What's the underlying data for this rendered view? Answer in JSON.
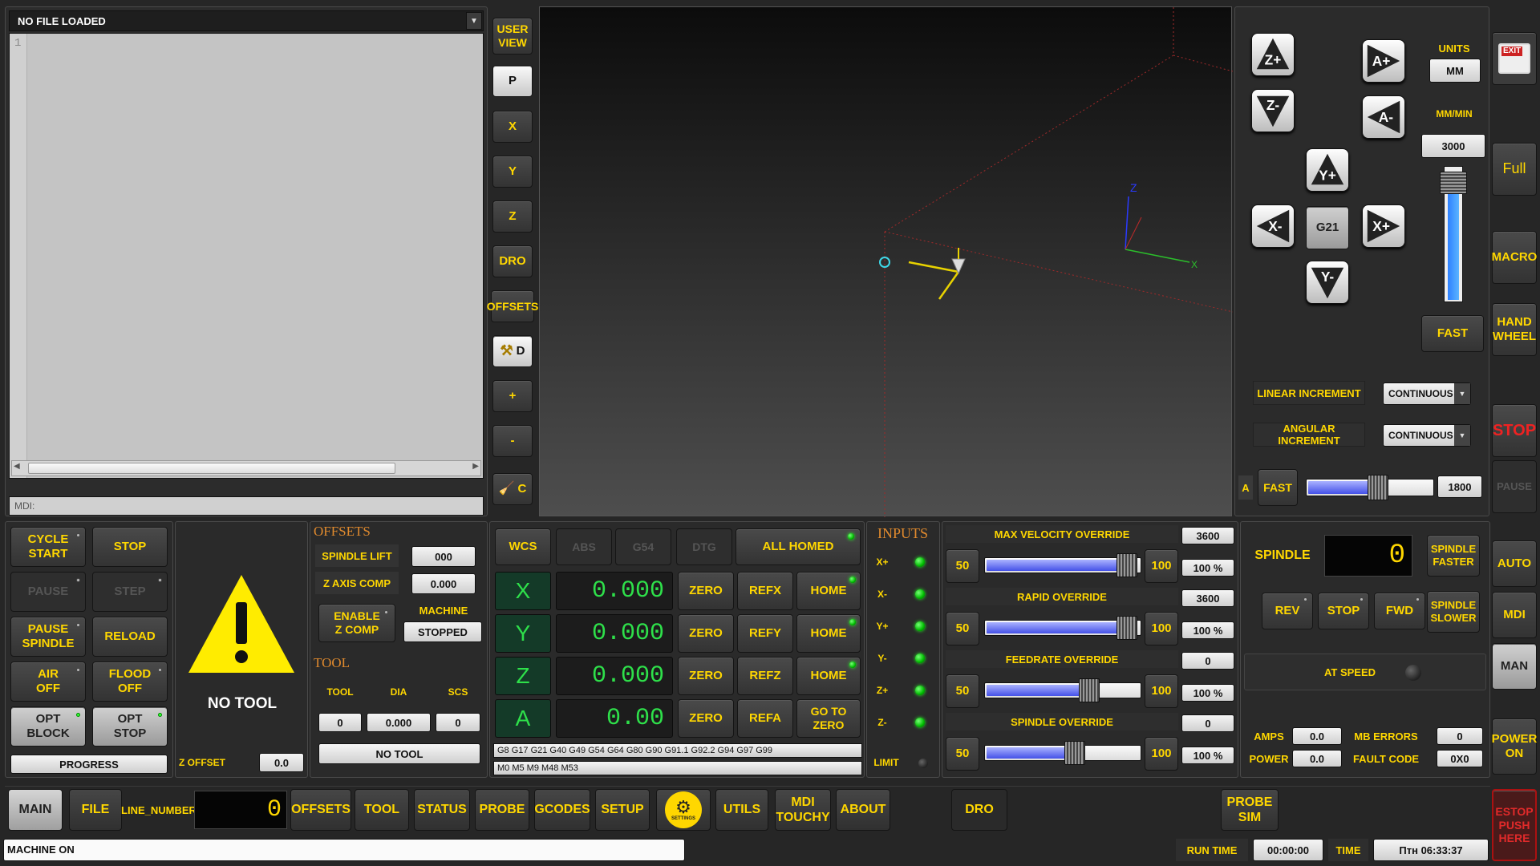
{
  "editor": {
    "title": "NO FILE LOADED",
    "line_number": "1",
    "mdi_label": "MDI:"
  },
  "view_toolbar": {
    "user_view": "USER\nVIEW",
    "p": "P",
    "x": "X",
    "y": "Y",
    "z": "Z",
    "dro": "DRO",
    "offsets": "OFFSETS",
    "d": "D",
    "plus": "+",
    "minus": "-",
    "c": "C"
  },
  "preview": {
    "axis_x": "X",
    "axis_z": "Z"
  },
  "jog": {
    "z_plus": "Z+",
    "z_minus": "Z-",
    "a_plus": "A+",
    "a_minus": "A-",
    "y_plus": "Y+",
    "y_minus": "Y-",
    "x_plus": "X+",
    "x_minus": "X-",
    "g21": "G21",
    "units_label": "UNITS",
    "units_value": "MM",
    "rate_unit": "MM/MIN",
    "rate_value": "3000",
    "jog_speed_pct": 0.88,
    "fast": "FAST",
    "linear_increment": "LINEAR INCREMENT",
    "linear_value": "CONTINUOUS",
    "angular_increment": "ANGULAR INCREMENT",
    "angular_value": "CONTINUOUS",
    "a_label": "A",
    "a_fast": "FAST",
    "a_value": "1800",
    "a_slider_pct": 0.58
  },
  "right_bar": {
    "exit": "EXIT",
    "full": "Full",
    "macro": "MACRO",
    "hand_wheel": "HAND\nWHEEL",
    "stop": "STOP",
    "pause": "PAUSE",
    "auto": "AUTO",
    "mdi": "MDI",
    "man": "MAN",
    "power_on": "POWER\nON",
    "estop": "ESTOP\nPUSH\nHERE"
  },
  "program": {
    "cycle_start": "CYCLE\nSTART",
    "stop": "STOP",
    "pause": "PAUSE",
    "step": "STEP",
    "pause_spindle": "PAUSE\nSPINDLE",
    "reload": "RELOAD",
    "air_off": "AIR\nOFF",
    "flood_off": "FLOOD\nOFF",
    "opt_block": "OPT\nBLOCK",
    "opt_stop": "OPT\nSTOP",
    "progress": "PROGRESS"
  },
  "tool_display": {
    "no_tool": "NO TOOL",
    "z_offset_label": "Z OFFSET",
    "z_offset_value": "0.0"
  },
  "offsets_panel": {
    "title": "OFFSETS",
    "spindle_lift_label": "SPINDLE LIFT",
    "spindle_lift_value": "000",
    "z_axis_comp_label": "Z AXIS COMP",
    "z_axis_comp_value": "0.000",
    "enable_z_comp": "ENABLE\nZ COMP",
    "machine_label": "MACHINE",
    "machine_state": "STOPPED",
    "tool_title": "TOOL",
    "col_tool": "TOOL",
    "col_dia": "DIA",
    "col_scs": "SCS",
    "tool_value": "0",
    "dia_value": "0.000",
    "scs_value": "0",
    "no_tool": "NO TOOL"
  },
  "dro": {
    "wcs": "WCS",
    "abs": "ABS",
    "g54": "G54",
    "dtg": "DTG",
    "all_homed": "ALL HOMED",
    "zero": "ZERO",
    "home": "HOME",
    "go_to_zero": "GO TO\nZERO",
    "axes": [
      {
        "name": "X",
        "value": "0.000",
        "ref": "REFX"
      },
      {
        "name": "Y",
        "value": "0.000",
        "ref": "REFY"
      },
      {
        "name": "Z",
        "value": "0.000",
        "ref": "REFZ"
      },
      {
        "name": "A",
        "value": "0.00",
        "ref": "REFA"
      }
    ],
    "gcodes": "G8 G17 G21 G40 G49 G54 G64 G80 G90 G91.1 G92.2 G94 G97 G99",
    "mcodes": "M0 M5 M9 M48 M53"
  },
  "inputs": {
    "title": "INPUTS",
    "items": [
      "X+",
      "X-",
      "Y+",
      "Y-",
      "Z+",
      "Z-"
    ],
    "limit": "LIMIT"
  },
  "overrides": [
    {
      "title": "MAX VELOCITY OVERRIDE",
      "min": "50",
      "max": "100",
      "value": "3600",
      "pct": "100 %",
      "level": 1.0
    },
    {
      "title": "RAPID OVERRIDE",
      "min": "50",
      "max": "100",
      "value": "3600",
      "pct": "100 %",
      "level": 1.0
    },
    {
      "title": "FEEDRATE OVERRIDE",
      "min": "50",
      "max": "100",
      "value": "0",
      "pct": "100 %",
      "level": 0.75
    },
    {
      "title": "SPINDLE OVERRIDE",
      "min": "50",
      "max": "100",
      "value": "0",
      "pct": "100 %",
      "level": 0.66
    }
  ],
  "spindle": {
    "title": "SPINDLE",
    "rpm": "0",
    "faster": "SPINDLE\nFASTER",
    "slower": "SPINDLE\nSLOWER",
    "rev": "REV",
    "stop": "STOP",
    "fwd": "FWD",
    "at_speed": "AT SPEED",
    "amps_label": "AMPS",
    "amps_value": "0.0",
    "power_label": "POWER",
    "power_value": "0.0",
    "mb_errors_label": "MB ERRORS",
    "mb_errors_value": "0",
    "fault_code_label": "FAULT CODE",
    "fault_code_value": "0X0"
  },
  "tabs": {
    "main": "MAIN",
    "file": "FILE",
    "line_number_label": "LINE_NUMBER",
    "line_number_value": "0",
    "offsets": "OFFSETS",
    "tool": "TOOL",
    "status": "STATUS",
    "probe": "PROBE",
    "gcodes": "GCODES",
    "setup": "SETUP",
    "settings": "SETTINGS",
    "utils": "UTILS",
    "mdi_touchy": "MDI\nTOUCHY",
    "about": "ABOUT",
    "dro": "DRO",
    "probe_sim": "PROBE\nSIM"
  },
  "status_bar": {
    "message": "MACHINE ON",
    "run_time_label": "RUN TIME",
    "run_time_value": "00:00:00",
    "time_label": "TIME",
    "time_value": "Птн 06:33:37"
  }
}
